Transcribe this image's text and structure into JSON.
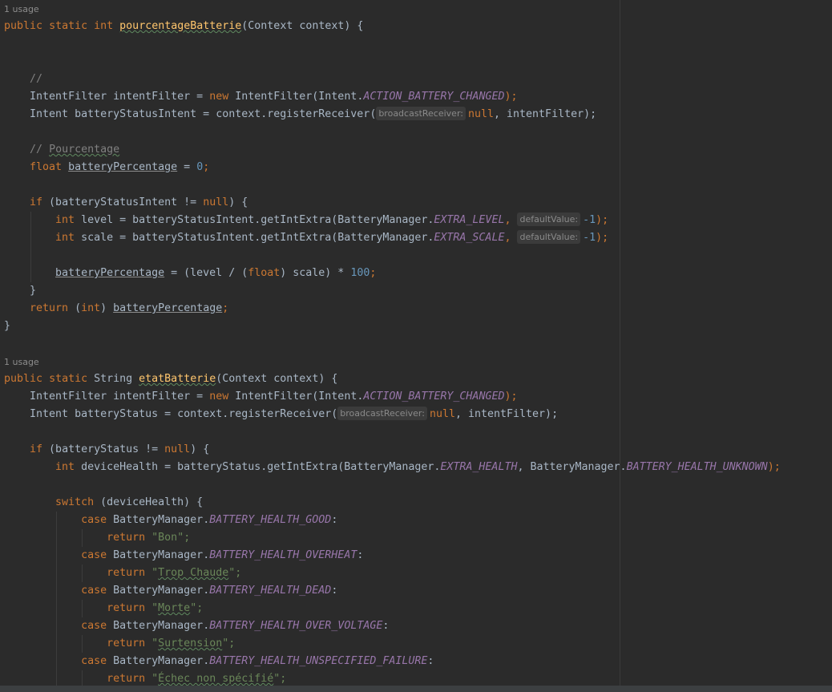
{
  "usages": [
    "1 usage",
    "1 usage"
  ],
  "hints": {
    "broadcast_receiver": "broadcastReceiver:",
    "default_value": "defaultValue:"
  },
  "code": {
    "pct": {
      "l1": [
        "public",
        " ",
        "static",
        " ",
        "int",
        " ",
        "pourcentageBatterie",
        "(Context context) {"
      ],
      "l2": [
        "//"
      ],
      "l3": [
        "IntentFilter intentFilter = ",
        "new",
        " IntentFilter(Intent.",
        "ACTION_BATTERY_CHANGED",
        ");"
      ],
      "l4": [
        "Intent batteryStatusIntent = context.registerReceiver(",
        "null",
        ", intentFilter);"
      ],
      "l5": [
        "// ",
        "Pourcentage"
      ],
      "l6": [
        "float",
        " ",
        "batteryPercentage",
        " = ",
        "0",
        ";"
      ],
      "l7": [
        "if",
        " (batteryStatusIntent != ",
        "null",
        ") {"
      ],
      "l8": [
        "int",
        " level = batteryStatusIntent.getIntExtra(BatteryManager.",
        "EXTRA_LEVEL",
        ", ",
        "-1",
        ");"
      ],
      "l9": [
        "int",
        " scale = batteryStatusIntent.getIntExtra(BatteryManager.",
        "EXTRA_SCALE",
        ", ",
        "-1",
        ");"
      ],
      "l10": [
        "batteryPercentage",
        " = (level / (",
        "float",
        ") scale) * ",
        "100",
        ";"
      ],
      "l11": [
        "}"
      ],
      "l12": [
        "return",
        " (",
        "int",
        ") ",
        "batteryPercentage",
        ";"
      ],
      "l13": [
        "}"
      ]
    },
    "etat": {
      "l1": [
        "public",
        " ",
        "static",
        " String ",
        "etatBatterie",
        "(Context context) {"
      ],
      "l2": [
        "IntentFilter intentFilter = ",
        "new",
        " IntentFilter(Intent.",
        "ACTION_BATTERY_CHANGED",
        ");"
      ],
      "l3": [
        "Intent batteryStatus = context.registerReceiver(",
        "null",
        ", intentFilter);"
      ],
      "l4": [
        "if",
        " (batteryStatus != ",
        "null",
        ") {"
      ],
      "l5": [
        "int",
        " deviceHealth = batteryStatus.getIntExtra(BatteryManager.",
        "EXTRA_HEALTH",
        ", BatteryManager.",
        "BATTERY_HEALTH_UNKNOWN",
        ");"
      ],
      "l6": [
        "switch",
        " (deviceHealth) {"
      ],
      "l7": [
        "case",
        " BatteryManager.",
        "BATTERY_HEALTH_GOOD",
        ":"
      ],
      "l8": [
        "return",
        " \"",
        "Bon",
        "\";"
      ],
      "l9": [
        "case",
        " BatteryManager.",
        "BATTERY_HEALTH_OVERHEAT",
        ":"
      ],
      "l10": [
        "return",
        " \"",
        "Trop Chaude",
        "\";"
      ],
      "l11": [
        "case",
        " BatteryManager.",
        "BATTERY_HEALTH_DEAD",
        ":"
      ],
      "l12": [
        "return",
        " \"",
        "Morte",
        "\";"
      ],
      "l13": [
        "case",
        " BatteryManager.",
        "BATTERY_HEALTH_OVER_VOLTAGE",
        ":"
      ],
      "l14": [
        "return",
        " \"",
        "Surtension",
        "\";"
      ],
      "l15": [
        "case",
        " BatteryManager.",
        "BATTERY_HEALTH_UNSPECIFIED_FAILURE",
        ":"
      ],
      "l16": [
        "return",
        " \"",
        "Échec non spécifié",
        "\";"
      ]
    }
  },
  "colors": {
    "background": "#2b2b2b",
    "keyword": "#cc7832",
    "identifier": "#a9b7c6",
    "constant": "#9876aa",
    "string": "#6a8759",
    "number": "#6897bb",
    "comment": "#808080",
    "method_declaration": "#ffc66d"
  }
}
